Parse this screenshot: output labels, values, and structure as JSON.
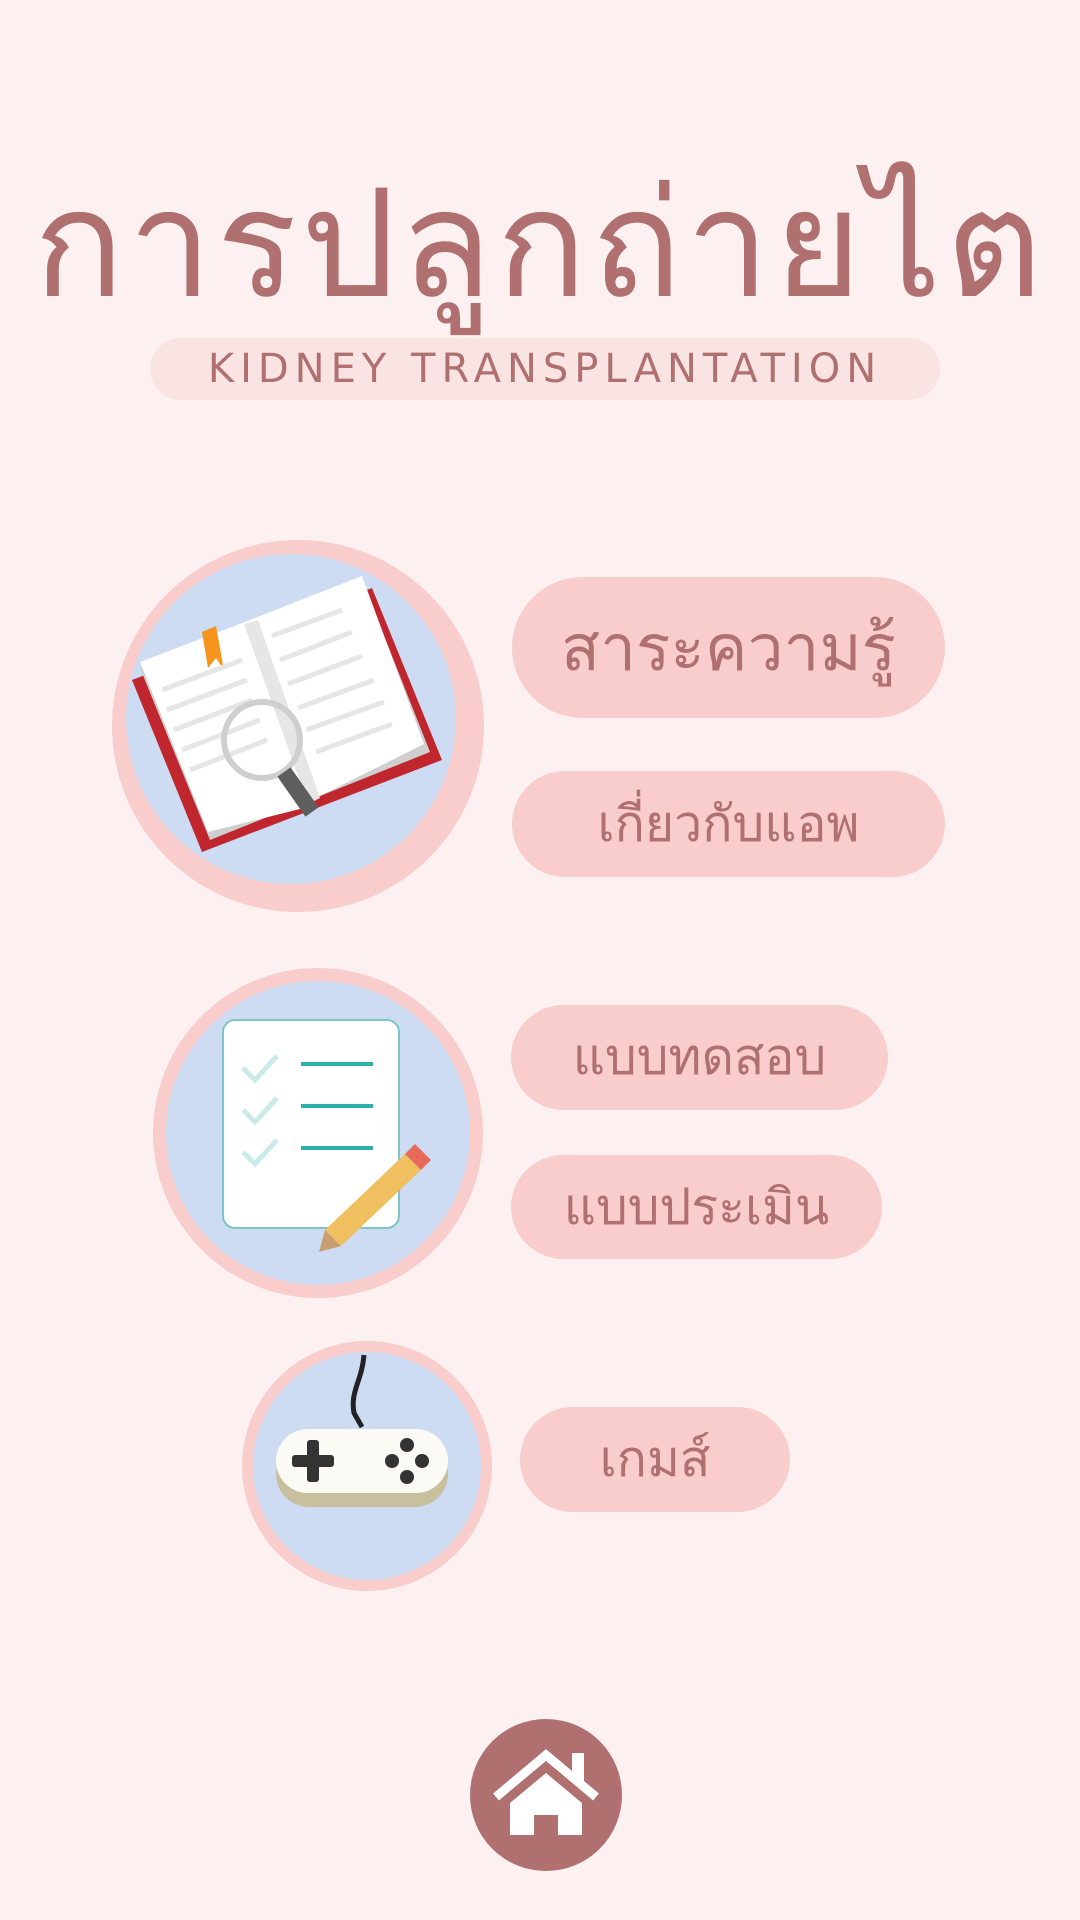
{
  "header": {
    "title": "การปลูกถ่ายไต",
    "subtitle": "KIDNEY TRANSPLANTATION"
  },
  "menu": {
    "knowledge": "สาระความรู้",
    "about": "เกี่ยวกับแอพ",
    "quiz": "แบบทดสอบ",
    "assessment": "แบบประเมิน",
    "games": "เกมส์"
  },
  "icons": {
    "knowledge": "book-magnifier-icon",
    "quiz": "checklist-pencil-icon",
    "games": "gamepad-icon",
    "home": "home-icon"
  },
  "colors": {
    "background": "#fdf0f0",
    "pill": "#f8cdcb",
    "text": "#b07070",
    "circle_inner": "#cddcf2"
  }
}
